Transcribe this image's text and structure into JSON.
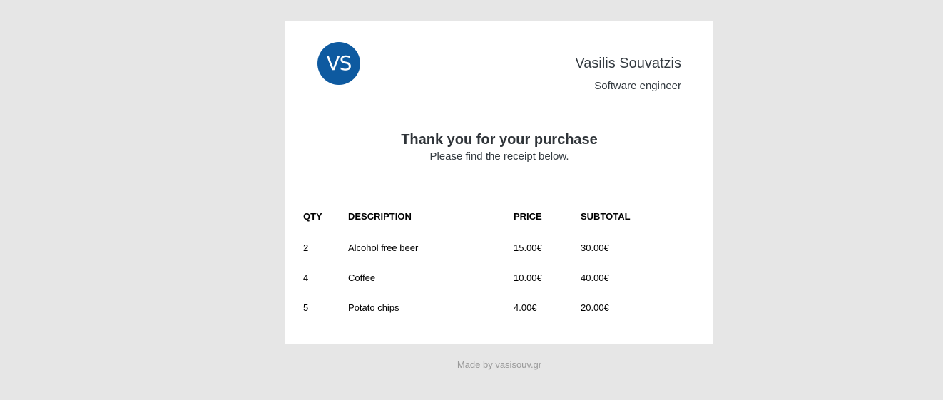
{
  "header": {
    "logo_initials": "VS",
    "name": "Vasilis Souvatzis",
    "role": "Software engineer"
  },
  "intro": {
    "heading": "Thank you for your purchase",
    "subheading": "Please find the receipt below."
  },
  "receipt": {
    "columns": [
      "QTY",
      "DESCRIPTION",
      "PRICE",
      "SUBTOTAL"
    ],
    "rows": [
      [
        "2",
        "Alcohol free beer",
        "15.00€",
        "30.00€"
      ],
      [
        "4",
        "Coffee",
        "10.00€",
        "40.00€"
      ],
      [
        "5",
        "Potato chips",
        "4.00€",
        "20.00€"
      ]
    ]
  },
  "footer": {
    "text": "Made by vasisouv.gr"
  },
  "colors": {
    "background": "#e6e6e6",
    "card": "#ffffff",
    "logo": "#0e5aa0",
    "footer_text": "#999999"
  }
}
